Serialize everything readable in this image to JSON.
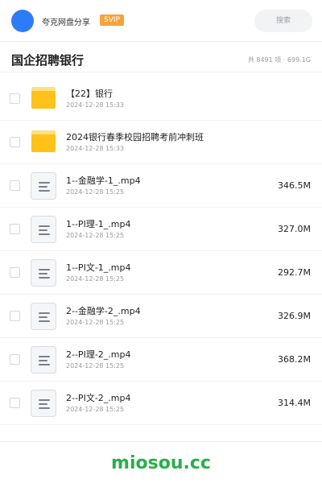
{
  "topbar": {
    "app_name": "夸克网盘分享",
    "badge": "SVIP",
    "search_placeholder": "搜索"
  },
  "header": {
    "title": "国企招聘银行",
    "stats": "共 8491 项 · 699.1G"
  },
  "files": [
    {
      "type": "folder",
      "name": "【22】银行",
      "date": "2024-12-28 15:33",
      "size": ""
    },
    {
      "type": "folder",
      "name": "2024银行春季校园招聘考前冲刺班",
      "date": "2024-12-28 15:33",
      "size": ""
    },
    {
      "type": "file",
      "name": "1--金融学-1_.mp4",
      "date": "2024-12-28 15:25",
      "size": "346.5M"
    },
    {
      "type": "file",
      "name": "1--PI理-1_.mp4",
      "date": "2024-12-28 15:25",
      "size": "327.0M"
    },
    {
      "type": "file",
      "name": "1--PI文-1_.mp4",
      "date": "2024-12-28 15:25",
      "size": "292.7M"
    },
    {
      "type": "file",
      "name": "2--金融学-2_.mp4",
      "date": "2024-12-28 15:25",
      "size": "326.9M"
    },
    {
      "type": "file",
      "name": "2--PI理-2_.mp4",
      "date": "2024-12-28 15:25",
      "size": "368.2M"
    },
    {
      "type": "file",
      "name": "2--PI文-2_.mp4",
      "date": "2024-12-28 15:25",
      "size": "314.4M"
    }
  ],
  "footer": {
    "watermark": "miosou.cc"
  },
  "colors": {
    "accent": "#2d7cf6",
    "svip": "#f7a23b",
    "folder": "#ffc21a",
    "watermark": "#27b04a"
  }
}
